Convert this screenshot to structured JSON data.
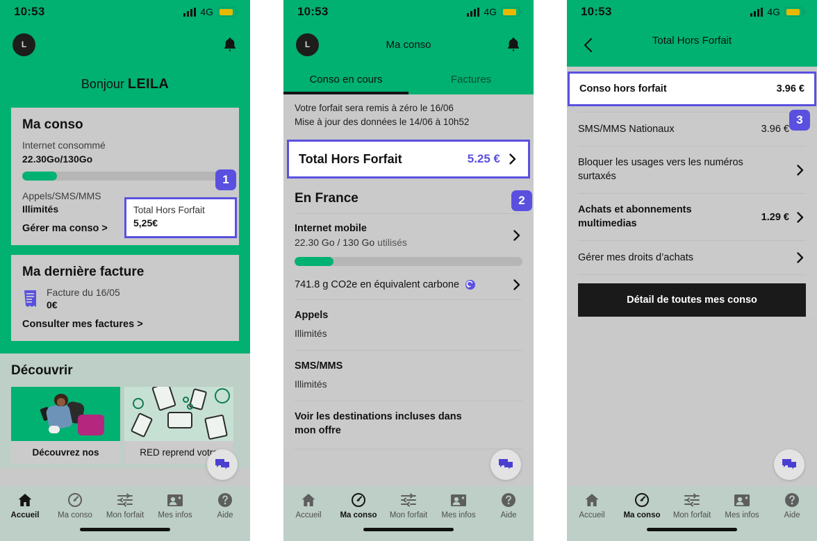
{
  "status_bar": {
    "time": "10:53",
    "network": "4G",
    "signal_icon": "signal-bars-icon",
    "battery_icon": "battery-icon"
  },
  "colors": {
    "brand_green": "#00b172",
    "accent_purple": "#5a50e0",
    "card_grey": "#cacaca",
    "nav_grey_green": "#bdcfc6",
    "black": "#1a1a1a"
  },
  "panel1": {
    "avatar_initial": "L",
    "bell_icon": "notification-bell-icon",
    "greeting_prefix": "Bonjour",
    "greeting_name": "LEILA",
    "conso_card": {
      "title": "Ma conso",
      "internet_label": "Internet consommé",
      "internet_value": "22.30Go/130Go",
      "progress_percent": 17,
      "calls_label": "Appels/SMS/MMS",
      "calls_value": "Illimités",
      "manage_link": "Gérer ma conso >",
      "highlight": {
        "title": "Total Hors Forfait",
        "amount": "5,25€",
        "badge": "1"
      }
    },
    "facture_card": {
      "title": "Ma dernière facture",
      "icon": "invoice-icon",
      "line1": "Facture du 16/05",
      "line2": "0€",
      "link": "Consulter mes factures >"
    },
    "discover": {
      "title": "Découvrir",
      "cards": [
        {
          "label": "Découvrez nos",
          "image": "traveler-photo",
          "bold": true
        },
        {
          "label": "RED  reprend votre",
          "image": "recycling-devices-illustration",
          "bold": false
        }
      ]
    },
    "fab_icon": "chat-bubble-icon",
    "nav": [
      {
        "label": "Accueil",
        "icon": "home-icon",
        "active": true
      },
      {
        "label": "Ma conso",
        "icon": "gauge-icon",
        "active": false
      },
      {
        "label": "Mon forfait",
        "icon": "sliders-icon",
        "active": false
      },
      {
        "label": "Mes infos",
        "icon": "id-card-icon",
        "active": false
      },
      {
        "label": "Aide",
        "icon": "help-icon",
        "active": false
      }
    ]
  },
  "panel2": {
    "avatar_initial": "L",
    "title": "Ma conso",
    "bell_icon": "notification-bell-icon",
    "tabs": [
      {
        "label": "Conso en cours",
        "active": true
      },
      {
        "label": "Factures",
        "active": false
      }
    ],
    "notice": [
      "Votre forfait sera remis à zéro le 16/06",
      "Mise à jour des données le 14/06 à 10h52"
    ],
    "total_hors_forfait": {
      "label": "Total Hors Forfait",
      "amount": "5.25 €",
      "chevron_icon": "chevron-right-icon"
    },
    "section_title": "En France",
    "badge": "2",
    "rows": [
      {
        "title": "Internet mobile",
        "sub": "22.30 Go / 130 Go ",
        "sub_muted": "utilisés",
        "progress_percent": 17,
        "chevron": true,
        "bold": true
      },
      {
        "title": "741.8 g CO2e en équivalent carbone",
        "icon": "carbon-footprint-icon",
        "chevron": true,
        "bold": false
      },
      {
        "title": "Appels",
        "sub": "Illimités",
        "chevron": false,
        "bold": true
      },
      {
        "title": "SMS/MMS",
        "sub": "Illimités",
        "chevron": false,
        "bold": true
      },
      {
        "title": "Voir les destinations incluses dans mon offre",
        "chevron": false,
        "bold": true
      }
    ],
    "fab_icon": "chat-bubble-icon",
    "nav": [
      {
        "label": "Accueil",
        "icon": "home-icon",
        "active": false
      },
      {
        "label": "Ma conso",
        "icon": "gauge-icon",
        "active": true
      },
      {
        "label": "Mon forfait",
        "icon": "sliders-icon",
        "active": false
      },
      {
        "label": "Mes infos",
        "icon": "id-card-icon",
        "active": false
      },
      {
        "label": "Aide",
        "icon": "help-icon",
        "active": false
      }
    ]
  },
  "panel3": {
    "back_icon": "chevron-left-icon",
    "title": "Total Hors Forfait",
    "highlight_row": {
      "label": "Conso hors forfait",
      "amount": "3.96 €"
    },
    "badge": "3",
    "rows": [
      {
        "title": "SMS/MMS Nationaux",
        "amount": "3.96 €",
        "chevron": false,
        "bold": false
      },
      {
        "title": "Bloquer les usages vers les numéros surtaxés",
        "amount": "",
        "chevron": true,
        "bold": false
      },
      {
        "title": "Achats et abonnements multimedias",
        "amount": "1.29 €",
        "chevron": true,
        "bold": true
      },
      {
        "title": "Gérer mes droits d’achats",
        "amount": "",
        "chevron": true,
        "bold": false
      }
    ],
    "detail_button": "Détail de toutes mes conso",
    "fab_icon": "chat-bubble-icon",
    "nav": [
      {
        "label": "Accueil",
        "icon": "home-icon",
        "active": false
      },
      {
        "label": "Ma conso",
        "icon": "gauge-icon",
        "active": true
      },
      {
        "label": "Mon forfait",
        "icon": "sliders-icon",
        "active": false
      },
      {
        "label": "Mes infos",
        "icon": "id-card-icon",
        "active": false
      },
      {
        "label": "Aide",
        "icon": "help-icon",
        "active": false
      }
    ]
  }
}
